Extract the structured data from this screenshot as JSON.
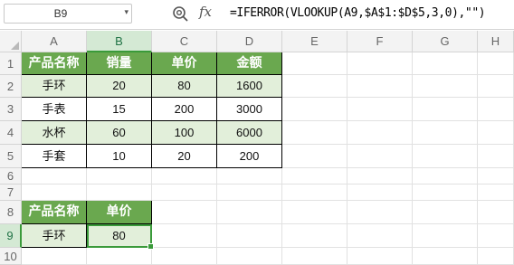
{
  "name_box": {
    "value": "B9"
  },
  "formula": {
    "fx_label": "fx",
    "text": "=IFERROR(VLOOKUP(A9,$A$1:$D$5,3,0),\"\")"
  },
  "columns": [
    "A",
    "B",
    "C",
    "D",
    "E",
    "F",
    "G",
    "H"
  ],
  "rows": [
    "1",
    "2",
    "3",
    "4",
    "5",
    "6",
    "7",
    "8",
    "9",
    "10"
  ],
  "selected_cell": "B9",
  "table1": {
    "headers": [
      "产品名称",
      "销量",
      "单价",
      "金额"
    ],
    "rows": [
      [
        "手环",
        "20",
        "80",
        "1600"
      ],
      [
        "手表",
        "15",
        "200",
        "3000"
      ],
      [
        "水杯",
        "60",
        "100",
        "6000"
      ],
      [
        "手套",
        "10",
        "20",
        "200"
      ]
    ]
  },
  "table2": {
    "headers": [
      "产品名称",
      "单价"
    ],
    "row": [
      "手环",
      "80"
    ]
  },
  "colors": {
    "header_green": "#6aa84f",
    "band_green": "#e2efda",
    "selection_green": "#3a9a3a"
  }
}
